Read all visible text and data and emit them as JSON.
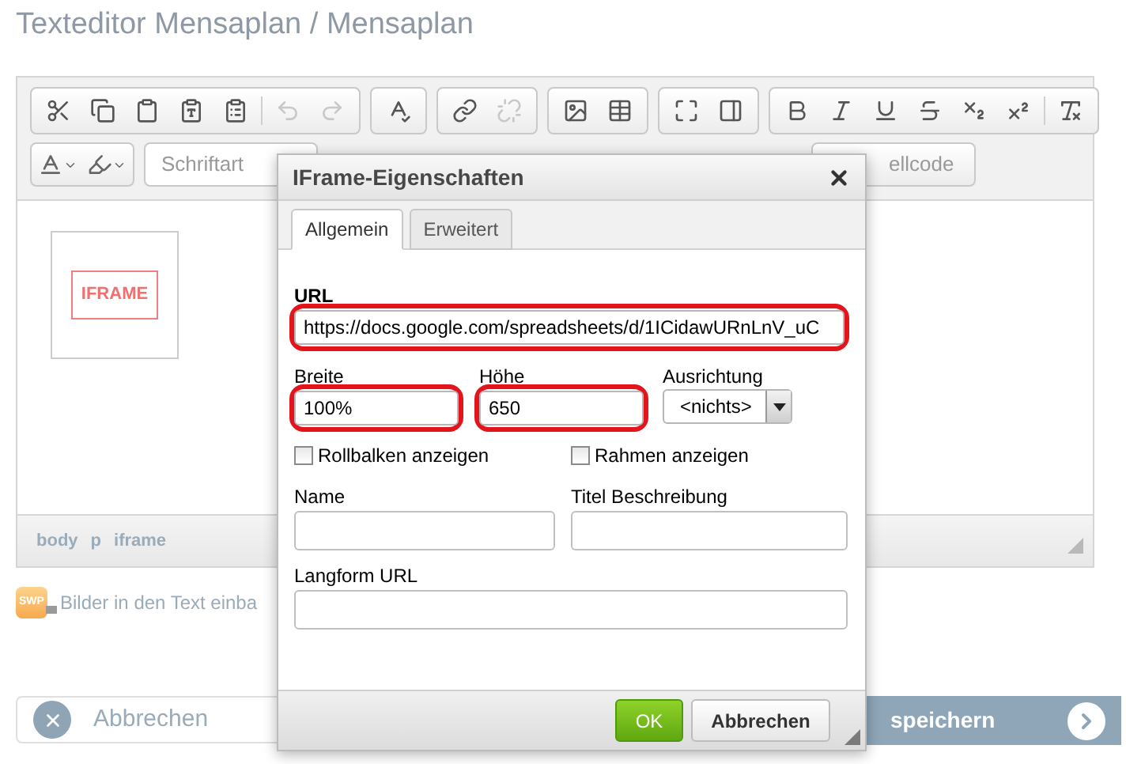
{
  "page_title": "Texteditor Mensaplan / Mensaplan",
  "toolbar": [
    [
      {
        "disabled": false
      },
      {
        "disabled": false
      },
      {
        "disabled": false
      },
      {
        "disabled": false
      },
      {
        "disabled": false
      },
      {
        "disabled": true
      },
      {
        "disabled": true
      }
    ],
    [
      {
        "disabled": false
      }
    ],
    [
      {
        "disabled": false
      },
      {
        "disabled": true
      }
    ],
    [
      {
        "disabled": false
      },
      {
        "disabled": false
      }
    ],
    [
      {
        "disabled": false
      },
      {
        "disabled": false
      }
    ],
    [
      {
        "disabled": false
      },
      {
        "disabled": false
      },
      {
        "disabled": false
      },
      {
        "disabled": false
      },
      {
        "disabled": false
      },
      {
        "disabled": false
      },
      {
        "disabled": false
      }
    ]
  ],
  "font_combo": {
    "placeholder": "Schriftart"
  },
  "source_button": "ellcode",
  "iframe_placeholder": "IFRAME",
  "status_path": [
    "body",
    "p",
    "iframe"
  ],
  "image_badge": "SWP",
  "image_link": "Bilder in den Text einba",
  "footer": {
    "cancel": "Abbrechen",
    "save": "speichern"
  },
  "dialog": {
    "title": "IFrame-Eigenschaften",
    "tabs": [
      {
        "label": "Allgemein",
        "selected": true
      },
      {
        "label": "Erweitert",
        "selected": false
      }
    ],
    "url": {
      "label": "URL",
      "value": "https://docs.google.com/spreadsheets/d/1ICidawURnLnV_uC",
      "highlighted": true
    },
    "width": {
      "label": "Breite",
      "value": "100%",
      "highlighted": true
    },
    "height": {
      "label": "Höhe",
      "value": "650",
      "highlighted": true
    },
    "align": {
      "label": "Ausrichtung",
      "value": "<nichts>"
    },
    "checkboxes": [
      {
        "label": "Rollbalken anzeigen",
        "checked": false
      },
      {
        "label": "Rahmen anzeigen",
        "checked": false
      }
    ],
    "name": {
      "label": "Name"
    },
    "title_desc": {
      "label": "Titel Beschreibung"
    },
    "longdesc": {
      "label": "Langform URL"
    },
    "ok": "OK",
    "cancel": "Abbrechen"
  }
}
